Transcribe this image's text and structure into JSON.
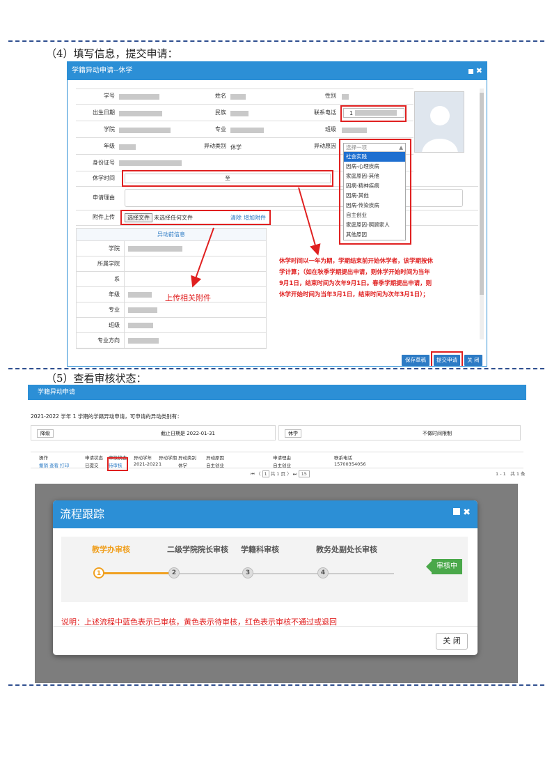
{
  "headings": {
    "step4": "（4）填写信息，提交申请：",
    "step5": "（5）查看审核状态："
  },
  "colors": {
    "accent": "#2c8fd6",
    "warning": "#e02020",
    "pending": "#f0a020",
    "ok_badge": "#4aa84a"
  },
  "apply_dialog": {
    "title": "学籍异动申请--休学",
    "labels": {
      "student_id": "学号",
      "name": "姓名",
      "gender": "性别",
      "birth": "出生日期",
      "ethnicity": "民族",
      "phone": "联系电话",
      "college": "学院",
      "major": "专业",
      "class": "班级",
      "grade": "年级",
      "change_type": "异动类别",
      "change_reason": "异动原因",
      "id_number": "身份证号",
      "suspension_time": "休学时间",
      "reason_text": "申请理由",
      "attachment": "附件上传"
    },
    "change_type_value": "休学",
    "phone_prefix": "1",
    "suspension_to": "至",
    "file_button": "选择文件",
    "file_status": "未选择任何文件",
    "clear_link": "清除",
    "add_attachment_link": "增加附件",
    "dropdown": {
      "placeholder": "选择一项",
      "options": [
        "社会实践",
        "因病-心理疾病",
        "家庭原因-其他",
        "因病-精神疾病",
        "因病-其他",
        "因病-传染疾病",
        "自主创业",
        "家庭原因-照顾家人",
        "其他原因"
      ],
      "highlighted": "社会实践"
    },
    "before_info": {
      "title": "异动前信息",
      "labels": [
        "学院",
        "所属学院",
        "系",
        "年级",
        "专业",
        "班级",
        "专业方向"
      ]
    },
    "annotation_upload": "上传相关附件",
    "note": "休学时间以一年为期，学期结束前开始休学者，该学期按休学计算；（如在秋季学期提出申请，则休学开始时间为当年9月1日，结束时间为次年9月1日。春季学期提出申请，则休学开始时间为当年3月1日，结束时间为次年3月1日）；",
    "buttons": {
      "save": "保存草稿",
      "submit": "提交申请",
      "close": "关 闭"
    }
  },
  "status_page": {
    "title": "学籍异动申请",
    "intro": "2021-2022 学年 1 学期的学籍异动申请，可申请的异动类别有：",
    "types": [
      {
        "name": "降级",
        "deadline": "截止日期是 2022-01-31"
      },
      {
        "name": "休学",
        "deadline": "不做时间限制"
      }
    ],
    "columns": [
      "操作",
      "申请状态",
      "审核状态",
      "异动学年",
      "异动学期",
      "异动类别",
      "异动原因",
      "申请理由",
      "联系电话"
    ],
    "row": {
      "ops": "撤销 查看 打印",
      "apply_status": "已提交",
      "audit_status": "待审核",
      "year": "2021-2022",
      "term": "1",
      "type": "休学",
      "reason": "自主创业",
      "reason_text": "自主创业",
      "phone": "15700354056"
    },
    "pager": {
      "page_input": "1",
      "total_pages": "共 1 页",
      "page_size": "15",
      "summary": "1 - 1　共 1 条"
    }
  },
  "process_dialog": {
    "title": "流程跟踪",
    "steps": [
      {
        "name": "教学办审核",
        "num": "1"
      },
      {
        "name": "二级学院院长审核",
        "num": "2"
      },
      {
        "name": "学籍科审核",
        "num": "3"
      },
      {
        "name": "教务处副处长审核",
        "num": "4"
      }
    ],
    "badge": "审核中",
    "desc": "说明：上述流程中蓝色表示已审核，黄色表示待审核，红色表示审核不通过或退回",
    "close": "关 闭"
  }
}
